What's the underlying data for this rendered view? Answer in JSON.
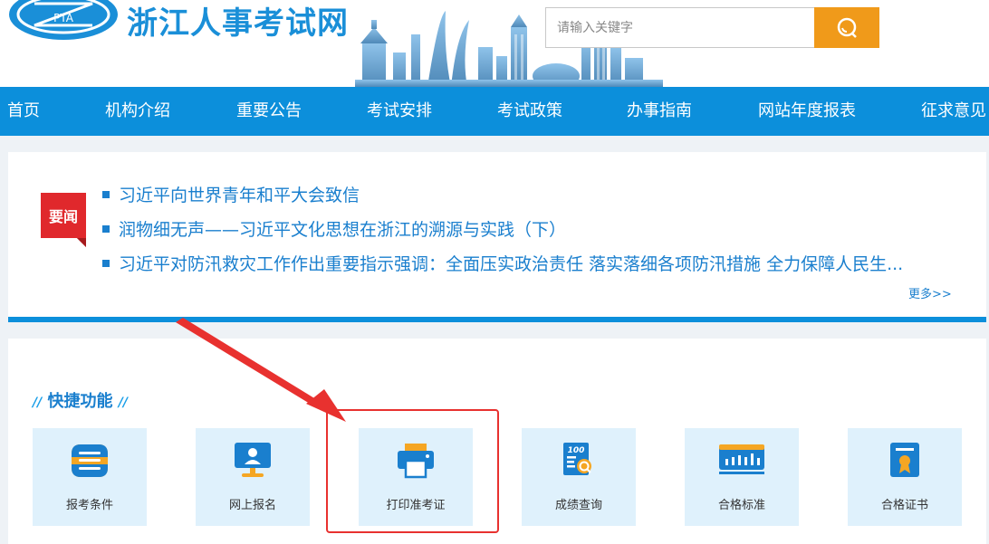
{
  "header": {
    "logo_text": "PTA",
    "site_title": "浙江人事考试网",
    "search_placeholder": "请输入关键字"
  },
  "nav": {
    "items": [
      "首页",
      "机构介绍",
      "重要公告",
      "考试安排",
      "考试政策",
      "办事指南",
      "网站年度报表",
      "征求意见"
    ]
  },
  "news": {
    "badge": "要闻",
    "items": [
      "习近平向世界青年和平大会致信",
      "润物细无声——习近平文化思想在浙江的溯源与实践（下）",
      "习近平对防汛救灾工作作出重要指示强调：全面压实政治责任 落实落细各项防汛措施 全力保障人民生..."
    ],
    "more": "更多>>"
  },
  "quick": {
    "title": "快捷功能",
    "tiles": [
      {
        "label": "报考条件",
        "icon": "conditions-icon"
      },
      {
        "label": "网上报名",
        "icon": "online-registration-icon"
      },
      {
        "label": "打印准考证",
        "icon": "printer-icon"
      },
      {
        "label": "成绩查询",
        "icon": "score-query-icon"
      },
      {
        "label": "合格标准",
        "icon": "qualification-standard-icon"
      },
      {
        "label": "合格证书",
        "icon": "certificate-icon"
      }
    ]
  },
  "colors": {
    "primary_blue": "#0c8fdb",
    "link_blue": "#1a7fce",
    "search_orange": "#f09a1a",
    "highlight_red": "#e8312f",
    "tile_bg": "#dff1fc"
  }
}
